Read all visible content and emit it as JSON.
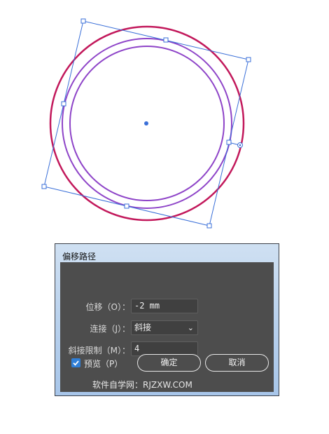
{
  "dialog": {
    "title": "偏移路径",
    "offset": {
      "label": "位移（O）：",
      "value": "-2 mm"
    },
    "joins": {
      "label": "连接（J）：",
      "value": "斜接"
    },
    "miter_limit": {
      "label": "斜接限制（M）：",
      "value": "4"
    },
    "preview": {
      "label": "预览（P）",
      "checked": true
    },
    "ok_label": "确定",
    "cancel_label": "取消",
    "watermark": "软件自学网：RJZXW.COM"
  },
  "colors": {
    "outer_circle": "#c2185b",
    "inner_circles": "#8e44c8",
    "bounding_box": "#3a6fd8",
    "checkbox_accent": "#2f7fd8"
  }
}
